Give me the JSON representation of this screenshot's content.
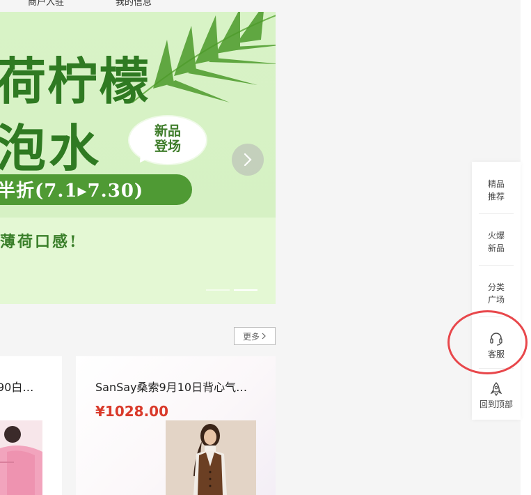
{
  "top_nav": {
    "left_text": "商户入驻",
    "right_text": "我的信息"
  },
  "banner": {
    "headline_line1": "荷柠檬",
    "headline_line2": "泡水",
    "bubble_line1": "新品",
    "bubble_line2": "登场",
    "promo_text": "半折(7.1▸7.30)",
    "sub_text": "薄荷口感!",
    "colors": {
      "headline": "#2f7a22",
      "pill": "#4f9a34",
      "background": "#d8f3c6"
    },
    "next_icon": "chevron-right-icon"
  },
  "more_button": {
    "label": "更多",
    "icon": "chevron-right-icon"
  },
  "products": [
    {
      "title": "90白…",
      "image": "pink-down-jacket-photo"
    },
    {
      "title": "SanSay桑索9月10日背心气…",
      "price": "¥1028.00",
      "image": "brown-vest-outfit-photo"
    }
  ],
  "side_toolbar": {
    "items": [
      {
        "line1": "精品",
        "line2": "推荐"
      },
      {
        "line1": "火爆",
        "line2": "新品"
      },
      {
        "line1": "分类",
        "line2": "广场"
      },
      {
        "label": "客服",
        "icon": "headset-icon"
      },
      {
        "label": "回到顶部",
        "icon": "rocket-icon"
      }
    ],
    "highlight_color": "#e8474b"
  },
  "accent_colors": {
    "price": "#d93a2b"
  }
}
